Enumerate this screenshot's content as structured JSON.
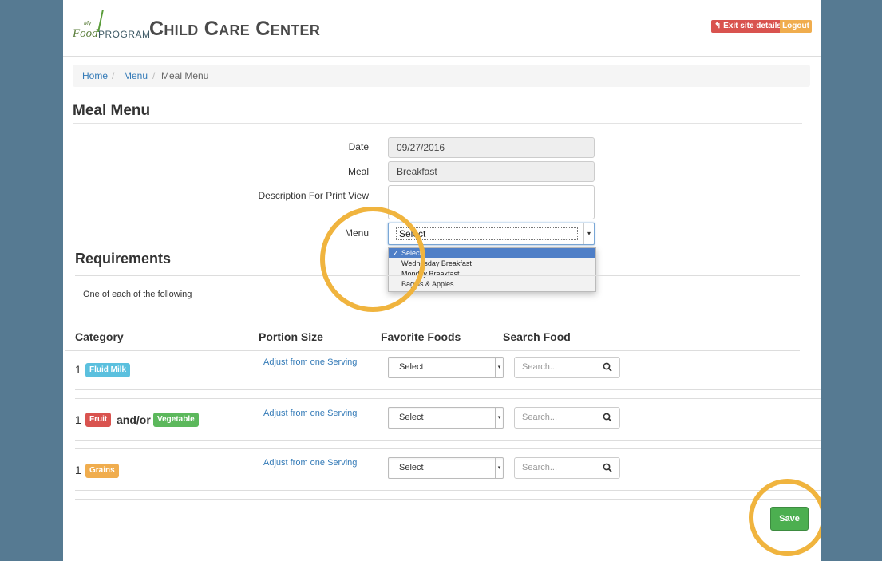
{
  "header": {
    "logo_my": "My",
    "logo_food": "Food",
    "logo_program": "PROGRAM",
    "site_title": "Child Care Center",
    "exit_label": "↰ Exit site details",
    "logout_label": "Logout"
  },
  "breadcrumb": {
    "items": [
      "Home",
      "Menu",
      "Meal Menu"
    ],
    "separator": "/"
  },
  "page_title": "Meal Menu",
  "form": {
    "date_label": "Date",
    "date_value": "09/27/2016",
    "meal_label": "Meal",
    "meal_value": "Breakfast",
    "description_label": "Description For Print View",
    "description_value": "",
    "menu_label": "Menu",
    "menu_selected": "Select",
    "menu_options": [
      "Select",
      "Wednesday Breakfast",
      "Monday Breakfast",
      "Bagels & Apples"
    ],
    "checkmark": "✓"
  },
  "requirements": {
    "title": "Requirements",
    "description": "One of each of the following",
    "columns": [
      "Category",
      "Portion Size",
      "Favorite Foods",
      "Search Food"
    ],
    "rows": [
      {
        "qty": "1",
        "badge1": "Fluid Milk",
        "adjust": "Adjust from one Serving",
        "favorite": "Select",
        "search_placeholder": "Search..."
      },
      {
        "qty": "1",
        "badge1": "Fruit",
        "and_or": "and/or",
        "badge2": "Vegetable",
        "adjust": "Adjust from one Serving",
        "favorite": "Select",
        "search_placeholder": "Search..."
      },
      {
        "qty": "1",
        "badge1": "Grains",
        "adjust": "Adjust from one Serving",
        "favorite": "Select",
        "search_placeholder": "Search..."
      }
    ]
  },
  "save_label": "Save",
  "colors": {
    "background": "#567a92",
    "highlight_ring": "#f0b43e",
    "fluid_milk_badge": "#5bc0de",
    "fruit_badge": "#d9534f",
    "vegetable_badge": "#5cb85c",
    "grains_badge": "#f0ad4e",
    "save_button": "#4caf50",
    "link": "#337ab7"
  },
  "icons": {
    "search": "magnifier-icon",
    "caret": "▾",
    "exit": "reply-arrow-icon"
  }
}
